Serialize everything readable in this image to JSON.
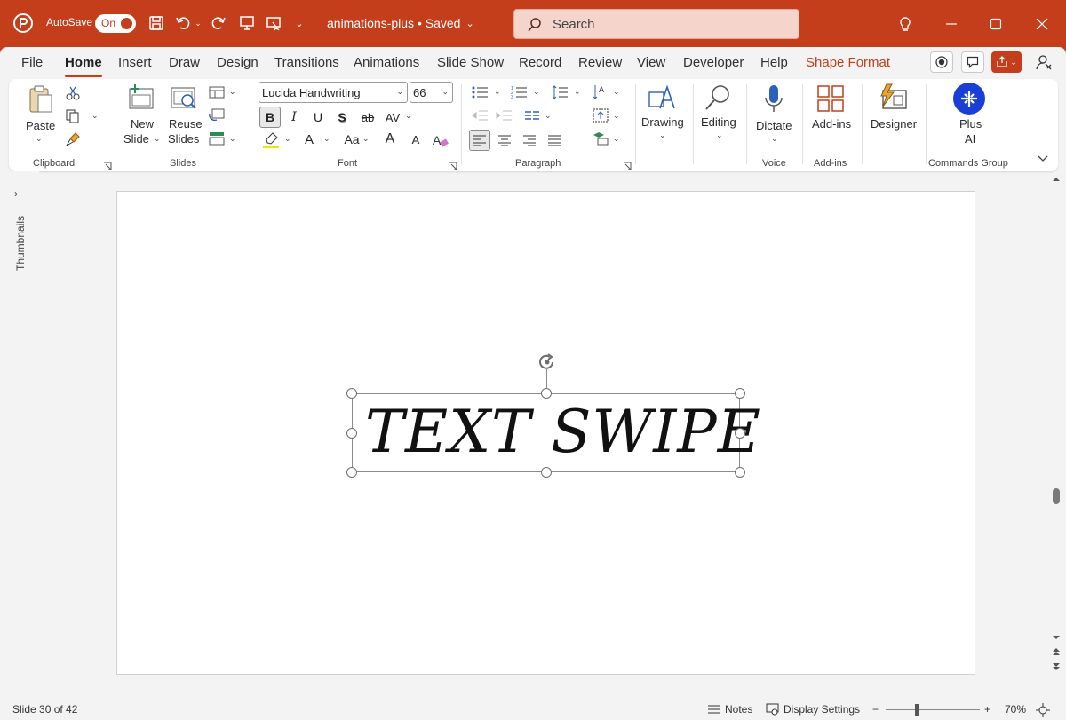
{
  "titlebar": {
    "autosave_label": "AutoSave",
    "autosave_state": "On",
    "doc_title": "animations-plus • Saved",
    "search_placeholder": "Search"
  },
  "tabs": [
    "File",
    "Home",
    "Insert",
    "Draw",
    "Design",
    "Transitions",
    "Animations",
    "Slide Show",
    "Record",
    "Review",
    "View",
    "Developer",
    "Help",
    "Shape Format"
  ],
  "active_tab": "Home",
  "ribbon": {
    "clipboard": {
      "paste": "Paste",
      "label": "Clipboard"
    },
    "slides": {
      "new_line1": "New",
      "new_line2": "Slide",
      "reuse_line1": "Reuse",
      "reuse_line2": "Slides",
      "label": "Slides"
    },
    "font": {
      "name": "Lucida Handwriting",
      "size": "66",
      "bold": "B",
      "italic": "I",
      "underline": "U",
      "shadow": "S",
      "strike": "ab",
      "spacing": "AV",
      "fontcolor": "A",
      "case": "Aa",
      "grow": "A",
      "shrink": "A",
      "label": "Font"
    },
    "paragraph": {
      "label": "Paragraph"
    },
    "drawing": "Drawing",
    "editing": "Editing",
    "voice": {
      "dictate": "Dictate",
      "label": "Voice"
    },
    "addins": {
      "btn": "Add-ins",
      "label": "Add-ins"
    },
    "designer": "Designer",
    "plus": {
      "line1": "Plus",
      "line2": "AI",
      "label": "Commands Group"
    }
  },
  "thumbnails_label": "Thumbnails",
  "slide": {
    "text": "TEXT SWIPE"
  },
  "status": {
    "slide_info": "Slide 30 of 42",
    "notes": "Notes",
    "display": "Display Settings",
    "zoom_minus": "−",
    "zoom_plus": "+",
    "zoom": "70%",
    "zoom_level": 0.7
  },
  "colors": {
    "accent": "#c43e1c",
    "plus_ai": "#1a3fd6"
  }
}
